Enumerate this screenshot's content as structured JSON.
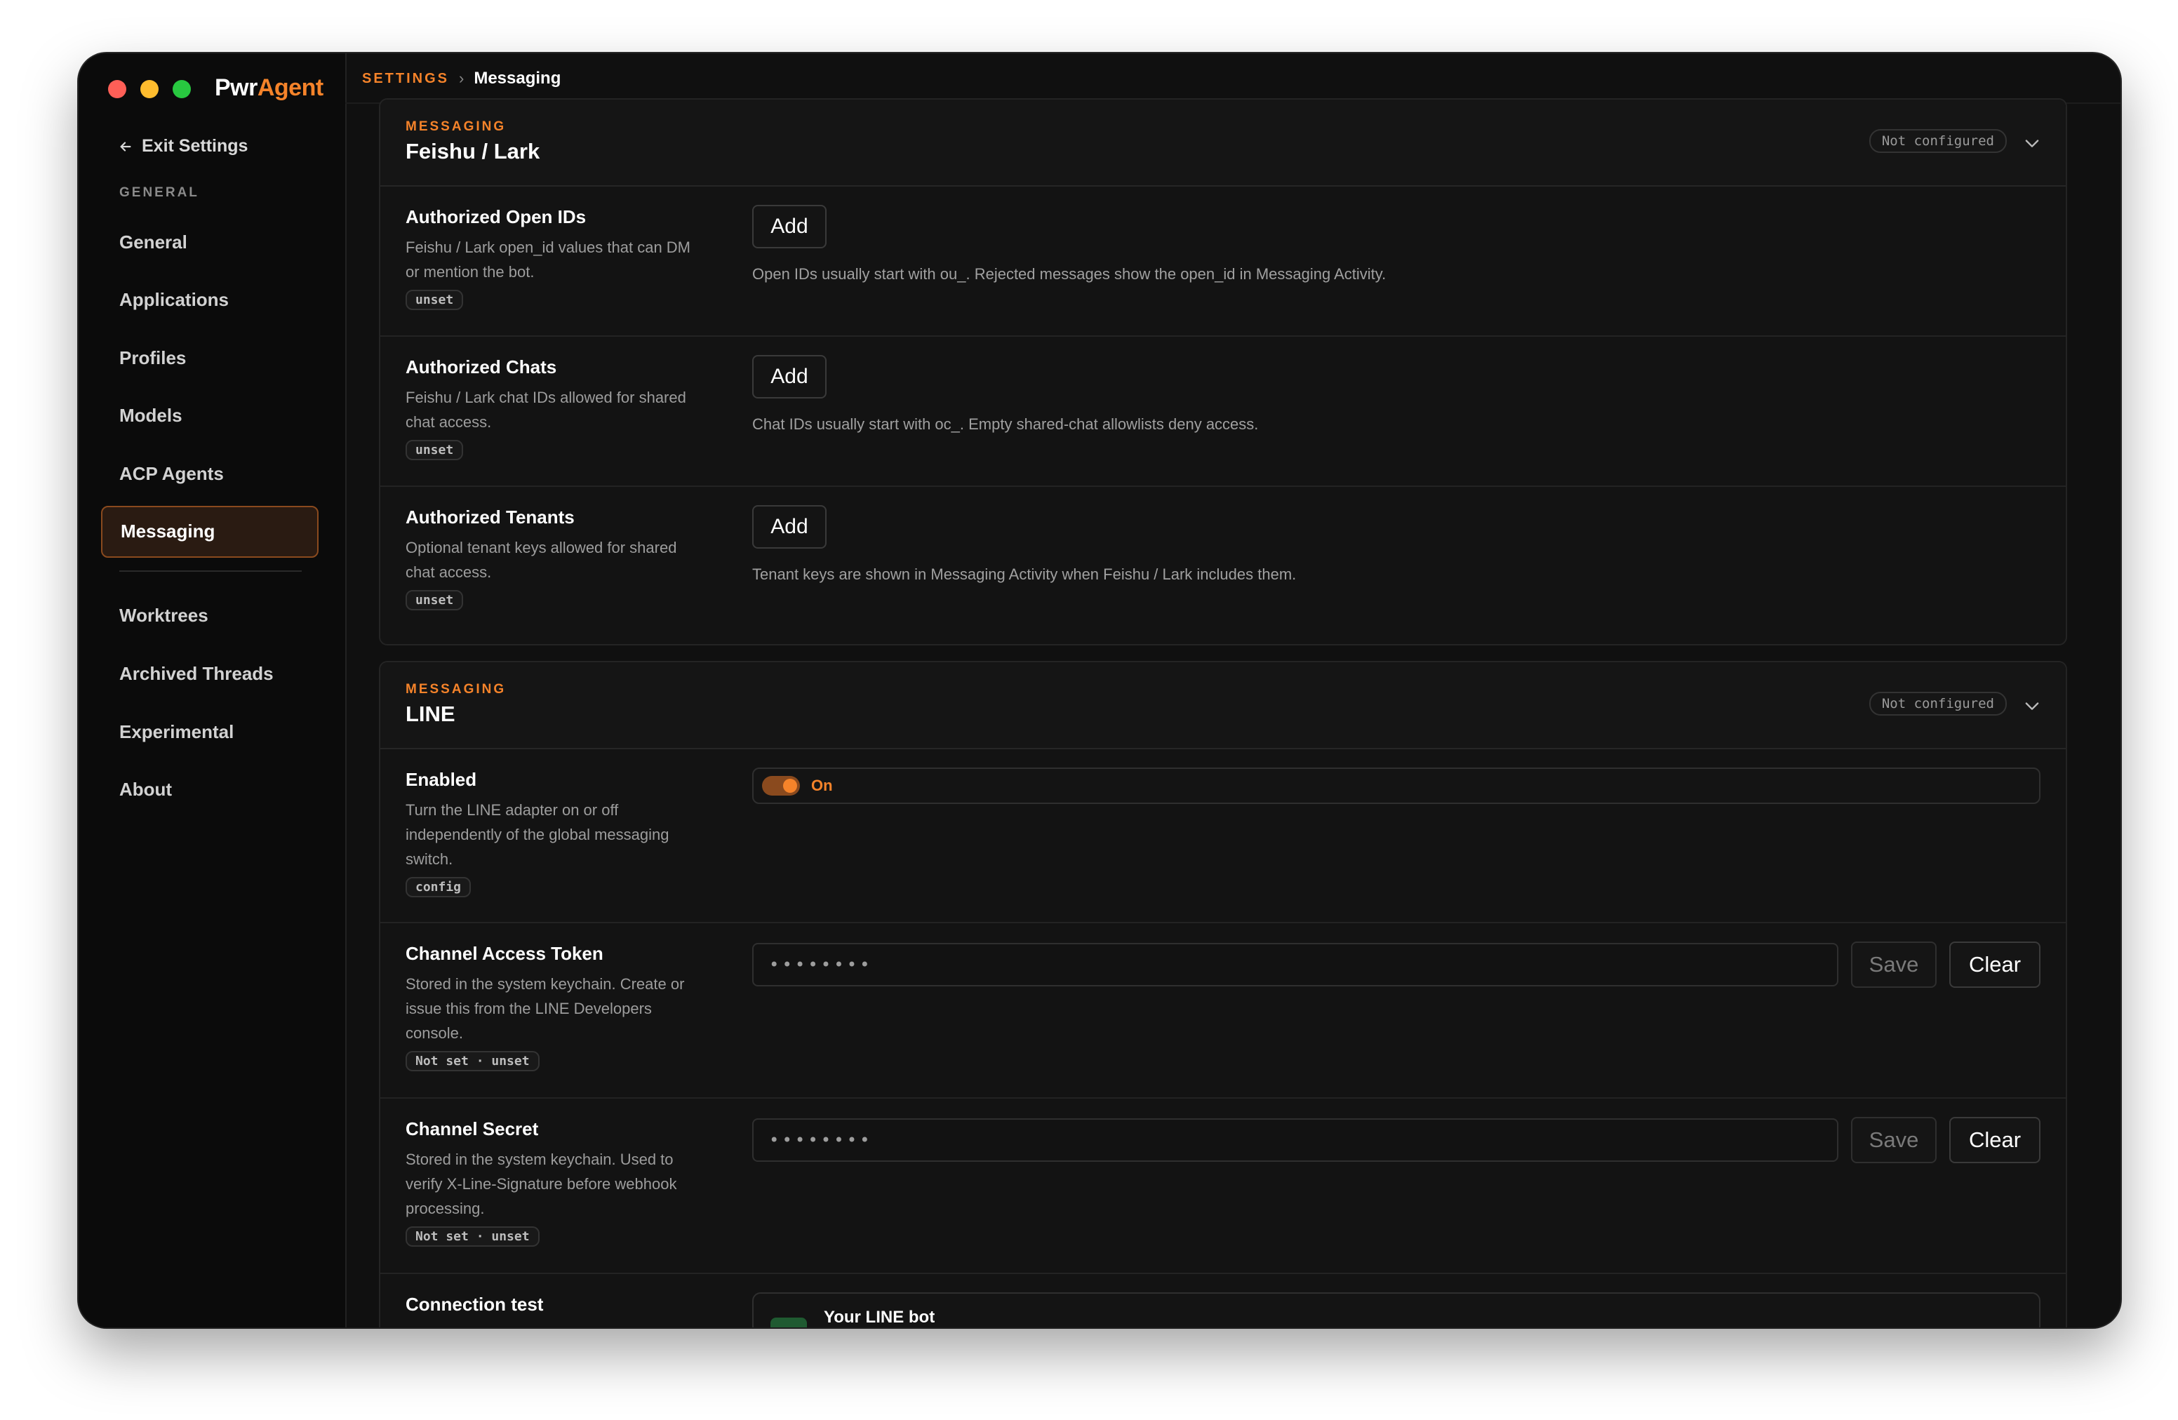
{
  "app": {
    "brand_a": "Pwr",
    "brand_b": "Agent"
  },
  "sidebar": {
    "exit_label": "Exit Settings",
    "section_label": "GENERAL",
    "items": [
      {
        "label": "General"
      },
      {
        "label": "Applications"
      },
      {
        "label": "Profiles"
      },
      {
        "label": "Models"
      },
      {
        "label": "ACP Agents"
      },
      {
        "label": "Messaging"
      },
      {
        "label": "Worktrees"
      },
      {
        "label": "Archived Threads"
      },
      {
        "label": "Experimental"
      },
      {
        "label": "About"
      }
    ],
    "active": "Messaging"
  },
  "breadcrumb": {
    "root": "SETTINGS",
    "separator": "›",
    "current": "Messaging"
  },
  "feishu": {
    "kicker": "MESSAGING",
    "title": "Feishu / Lark",
    "status": "Not configured",
    "rows": [
      {
        "title": "Authorized Open IDs",
        "desc": "Feishu / Lark open_id values that can DM or mention the bot.",
        "tag": "unset",
        "button": "Add",
        "hint": "Open IDs usually start with ou_. Rejected messages show the open_id in Messaging Activity."
      },
      {
        "title": "Authorized Chats",
        "desc": "Feishu / Lark chat IDs allowed for shared chat access.",
        "tag": "unset",
        "button": "Add",
        "hint": "Chat IDs usually start with oc_. Empty shared-chat allowlists deny access."
      },
      {
        "title": "Authorized Tenants",
        "desc": "Optional tenant keys allowed for shared chat access.",
        "tag": "unset",
        "button": "Add",
        "hint": "Tenant keys are shown in Messaging Activity when Feishu / Lark includes them."
      }
    ]
  },
  "line": {
    "kicker": "MESSAGING",
    "title": "LINE",
    "status": "Not configured",
    "enabled": {
      "title": "Enabled",
      "desc": "Turn the LINE adapter on or off independently of the global messaging switch.",
      "tag": "config",
      "toggle_label": "On"
    },
    "token": {
      "title": "Channel Access Token",
      "desc": "Stored in the system keychain. Create or issue this from the LINE Developers console.",
      "tag": "Not set · unset",
      "value": "••••••••",
      "save": "Save",
      "clear": "Clear"
    },
    "secret": {
      "title": "Channel Secret",
      "desc": "Stored in the system keychain. Used to verify X-Line-Signature before webhook processing.",
      "tag": "Not set · unset",
      "value": "••••••••",
      "save": "Save",
      "clear": "Clear"
    },
    "connection": {
      "title": "Connection test",
      "bot_name": "Your LINE bot"
    }
  }
}
